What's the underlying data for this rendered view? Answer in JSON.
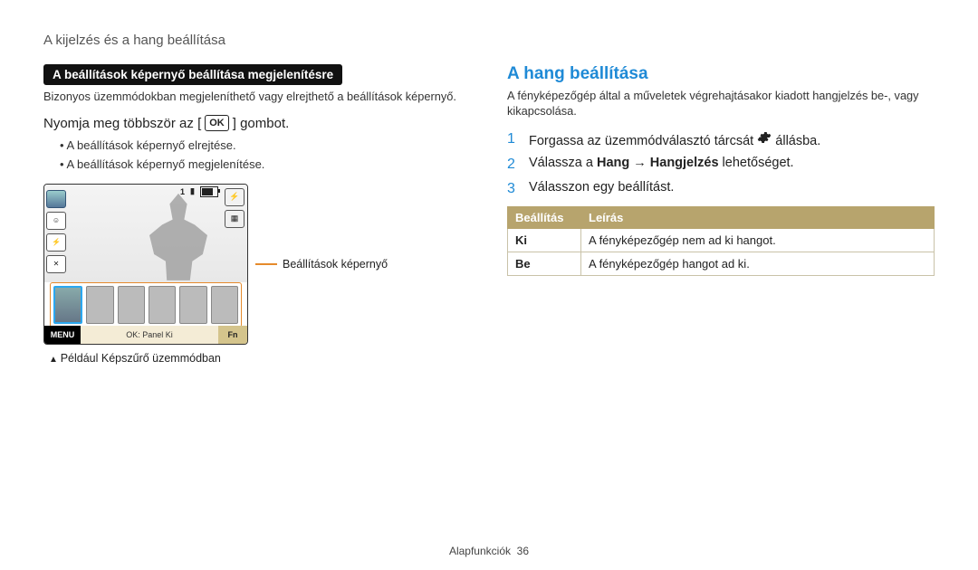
{
  "breadcrumb": "A kijelzés és a hang beállítása",
  "left": {
    "heading_bar": "A beállítások képernyő beállítása megjelenítésre",
    "intro": "Bizonyos üzemmódokban megjeleníthető vagy elrejthető a beállítások képernyő.",
    "press_line_prefix": "Nyomja meg többször az [",
    "press_line_ok": "OK",
    "press_line_suffix": "] gombot.",
    "bullets": {
      "hide": "A beállítások képernyő elrejtése.",
      "show": "A beállítások képernyő megjelenítése."
    },
    "camera": {
      "top_num": "1",
      "menu": "MENU",
      "mid": "OK: Panel Ki",
      "fn": "Fn"
    },
    "callout_label": "Beállítások képernyő",
    "caption_below": "Például Képszűrő üzemmódban"
  },
  "right": {
    "heading": "A hang beállítása",
    "intro": "A fényképezőgép által a műveletek végrehajtásakor kiadott hangjelzés be-, vagy kikapcsolása.",
    "steps": {
      "s1_prefix": "Forgassa az üzemmódválasztó tárcsát ",
      "s1_suffix": " állásba.",
      "s2_pre": "Válassza a ",
      "s2_b1": "Hang",
      "s2_arrow": " → ",
      "s2_b2": "Hangjelzés",
      "s2_post": " lehetőséget.",
      "s3": "Válasszon egy beállítást."
    },
    "table": {
      "h1": "Beállítás",
      "h2": "Leírás",
      "r1k": "Ki",
      "r1v": "A fényképezőgép nem ad ki hangot.",
      "r2k": "Be",
      "r2v": "A fényképezőgép hangot ad ki."
    }
  },
  "footer": {
    "section": "Alapfunkciók",
    "page": "36"
  }
}
